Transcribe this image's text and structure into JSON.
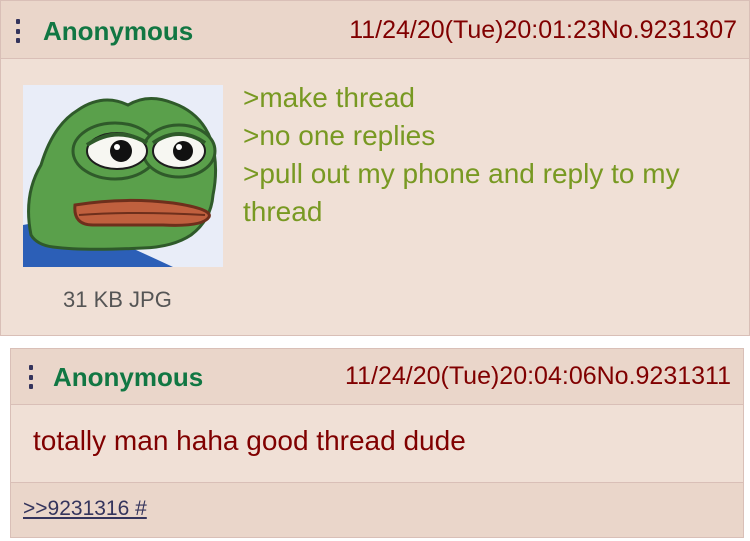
{
  "op": {
    "name": "Anonymous",
    "datetime": "11/24/20(Tue)20:01:23",
    "post_no": "No.9231307",
    "file_info": "31 KB JPG",
    "lines": [
      ">make thread",
      ">no one replies",
      ">pull out my phone and reply to my thread"
    ]
  },
  "reply": {
    "name": "Anonymous",
    "datetime": "11/24/20(Tue)20:04:06",
    "post_no": "No.9231311",
    "comment": "totally man haha good thread dude",
    "backlink": ">>9231316 #"
  },
  "colors": {
    "post_bg": "#f0e0d6",
    "header_bg": "#ead6ca",
    "name": "#117743",
    "meta": "#800000",
    "greentext": "#789922",
    "link": "#34345c"
  },
  "icons": {
    "menu": "vertical-dots-icon",
    "thumbnail": "frog-face-image"
  }
}
